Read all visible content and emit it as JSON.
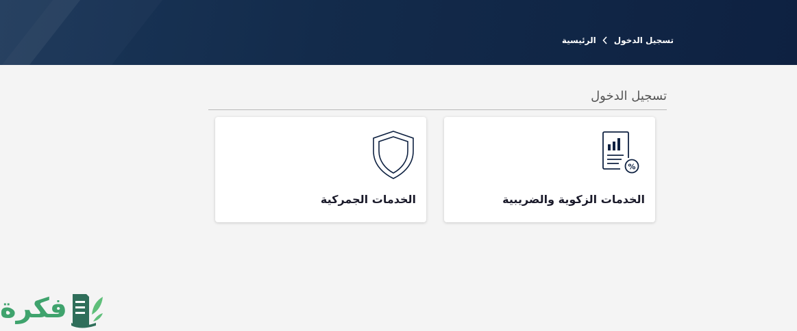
{
  "breadcrumb": {
    "home_label": "الرئيسية",
    "current_label": "تسجيل الدخول"
  },
  "section": {
    "title": "تسجيل الدخول"
  },
  "cards": [
    {
      "label": "الخدمات الزكوية والضريبية",
      "icon": "tax-report-icon"
    },
    {
      "label": "الخدمات الجمركية",
      "icon": "shield-icon"
    }
  ],
  "watermark": {
    "text": "فكرة"
  },
  "colors": {
    "header": "#132b4b",
    "background": "#f4f4f4",
    "icon": "#0e2141",
    "logo": "#3fa36d"
  }
}
